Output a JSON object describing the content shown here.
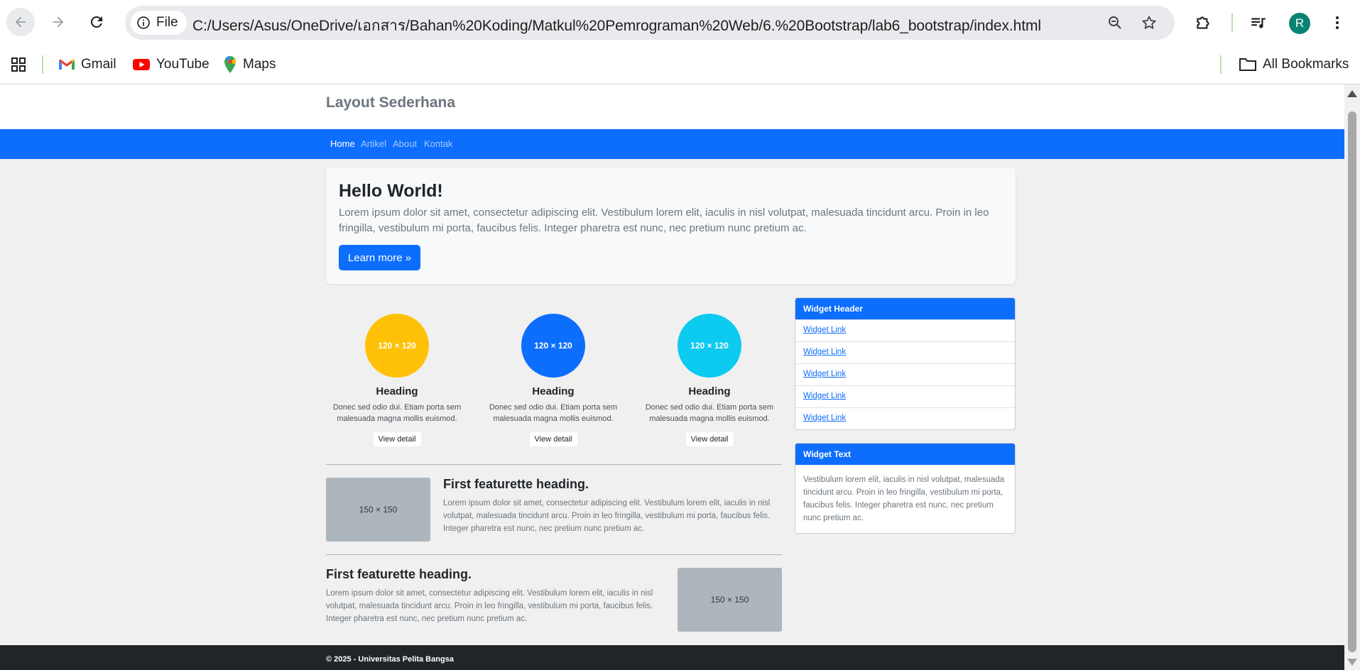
{
  "browser": {
    "site_chip_label": "File",
    "url": "C:/Users/Asus/OneDrive/เอกสาร/Bahan%20Koding/Matkul%20Pemrograman%20Web/6.%20Bootstrap/lab6_bootstrap/index.html",
    "profile_initial": "R",
    "bookmarks": [
      {
        "label": "Gmail",
        "icon": "gmail-icon"
      },
      {
        "label": "YouTube",
        "icon": "youtube-icon"
      },
      {
        "label": "Maps",
        "icon": "maps-icon"
      }
    ],
    "all_bookmarks_label": "All Bookmarks"
  },
  "page": {
    "site_title": "Layout Sederhana",
    "nav": [
      "Home",
      "Artikel",
      "About",
      "Kontak"
    ],
    "active_nav": "Home",
    "jumbotron": {
      "title": "Hello World!",
      "text": "Lorem ipsum dolor sit amet, consectetur adipiscing elit. Vestibulum lorem elit, iaculis in nisl volutpat, malesuada tincidunt arcu. Proin in leo fringilla, vestibulum mi porta, faucibus felis. Integer pharetra est nunc, nec pretium nunc pretium ac.",
      "button": "Learn more »"
    },
    "columns": [
      {
        "image_label": "120 × 120",
        "color": "#ffc107",
        "heading": "Heading",
        "text": "Donec sed odio dui. Etiam porta sem malesuada magna mollis euismod.",
        "button": "View detail"
      },
      {
        "image_label": "120 × 120",
        "color": "#0d6efd",
        "heading": "Heading",
        "text": "Donec sed odio dui. Etiam porta sem malesuada magna mollis euismod.",
        "button": "View detail"
      },
      {
        "image_label": "120 × 120",
        "color": "#0dcaf0",
        "heading": "Heading",
        "text": "Donec sed odio dui. Etiam porta sem malesuada magna mollis euismod.",
        "button": "View detail"
      }
    ],
    "featurettes": [
      {
        "image_label": "150 × 150",
        "heading": "First featurette heading.",
        "text": "Lorem ipsum dolor sit amet, consectetur adipiscing elit. Vestibulum lorem elit, iaculis in nisl volutpat, malesuada tincidunt arcu. Proin in leo fringilla, vestibulum mi porta, faucibus felis. Integer pharetra est nunc, nec pretium nunc pretium ac."
      },
      {
        "image_label": "150 × 150",
        "heading": "First featurette heading.",
        "text": "Lorem ipsum dolor sit amet, consectetur adipiscing elit. Vestibulum lorem elit, iaculis in nisl volutpat, malesuada tincidunt arcu. Proin in leo fringilla, vestibulum mi porta, faucibus felis. Integer pharetra est nunc, nec pretium nunc pretium ac."
      }
    ],
    "widget_links": {
      "header": "Widget Header",
      "links": [
        "Widget Link",
        "Widget Link",
        "Widget Link",
        "Widget Link",
        "Widget Link"
      ]
    },
    "widget_text": {
      "header": "Widget Text",
      "body": "Vestibulum lorem elit, iaculis in nisl volutpat, malesuada tincidunt arcu. Proin in leo fringilla, vestibulum mi porta, faucibus felis. Integer pharetra est nunc, nec pretium nunc pretium ac."
    },
    "footer": "© 2025 - Universitas Pelita Bangsa"
  },
  "colors": {
    "primary": "#0d6efd",
    "warning": "#ffc107",
    "info": "#0dcaf0",
    "footer_bg": "#212529",
    "page_bg": "#f0f0f0"
  }
}
